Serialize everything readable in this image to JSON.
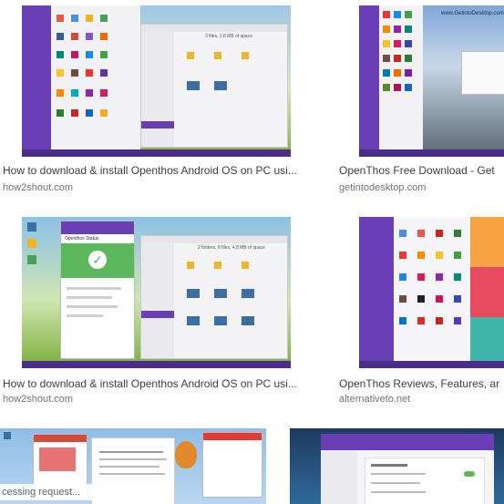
{
  "results": [
    {
      "title": "How to download & install Openthos Android OS on PC usi...",
      "source": "how2shout.com"
    },
    {
      "title": "OpenThos Free Download - Get",
      "source": "getintodesktop.com"
    },
    {
      "title": "How to download & install Openthos Android OS on PC usi...",
      "source": "how2shout.com"
    },
    {
      "title": "OpenThos Reviews, Features, ar",
      "source": "alternativeto.net"
    }
  ],
  "thumb_text": {
    "t2_watermark": "www.GetintoDesktop.com",
    "t3_dialog_title": "Openthos Status",
    "t1_file_info": "3 files, 2.8 MB of space",
    "t3_file_info": "2 folders, 6 files, 4.8 MB of space"
  },
  "status_text": "cessing request...",
  "colors": {
    "purple": "#6a3fb5",
    "green": "#5cb85c",
    "sky": "#6fa8dc",
    "grass": "#8fbf3a"
  }
}
